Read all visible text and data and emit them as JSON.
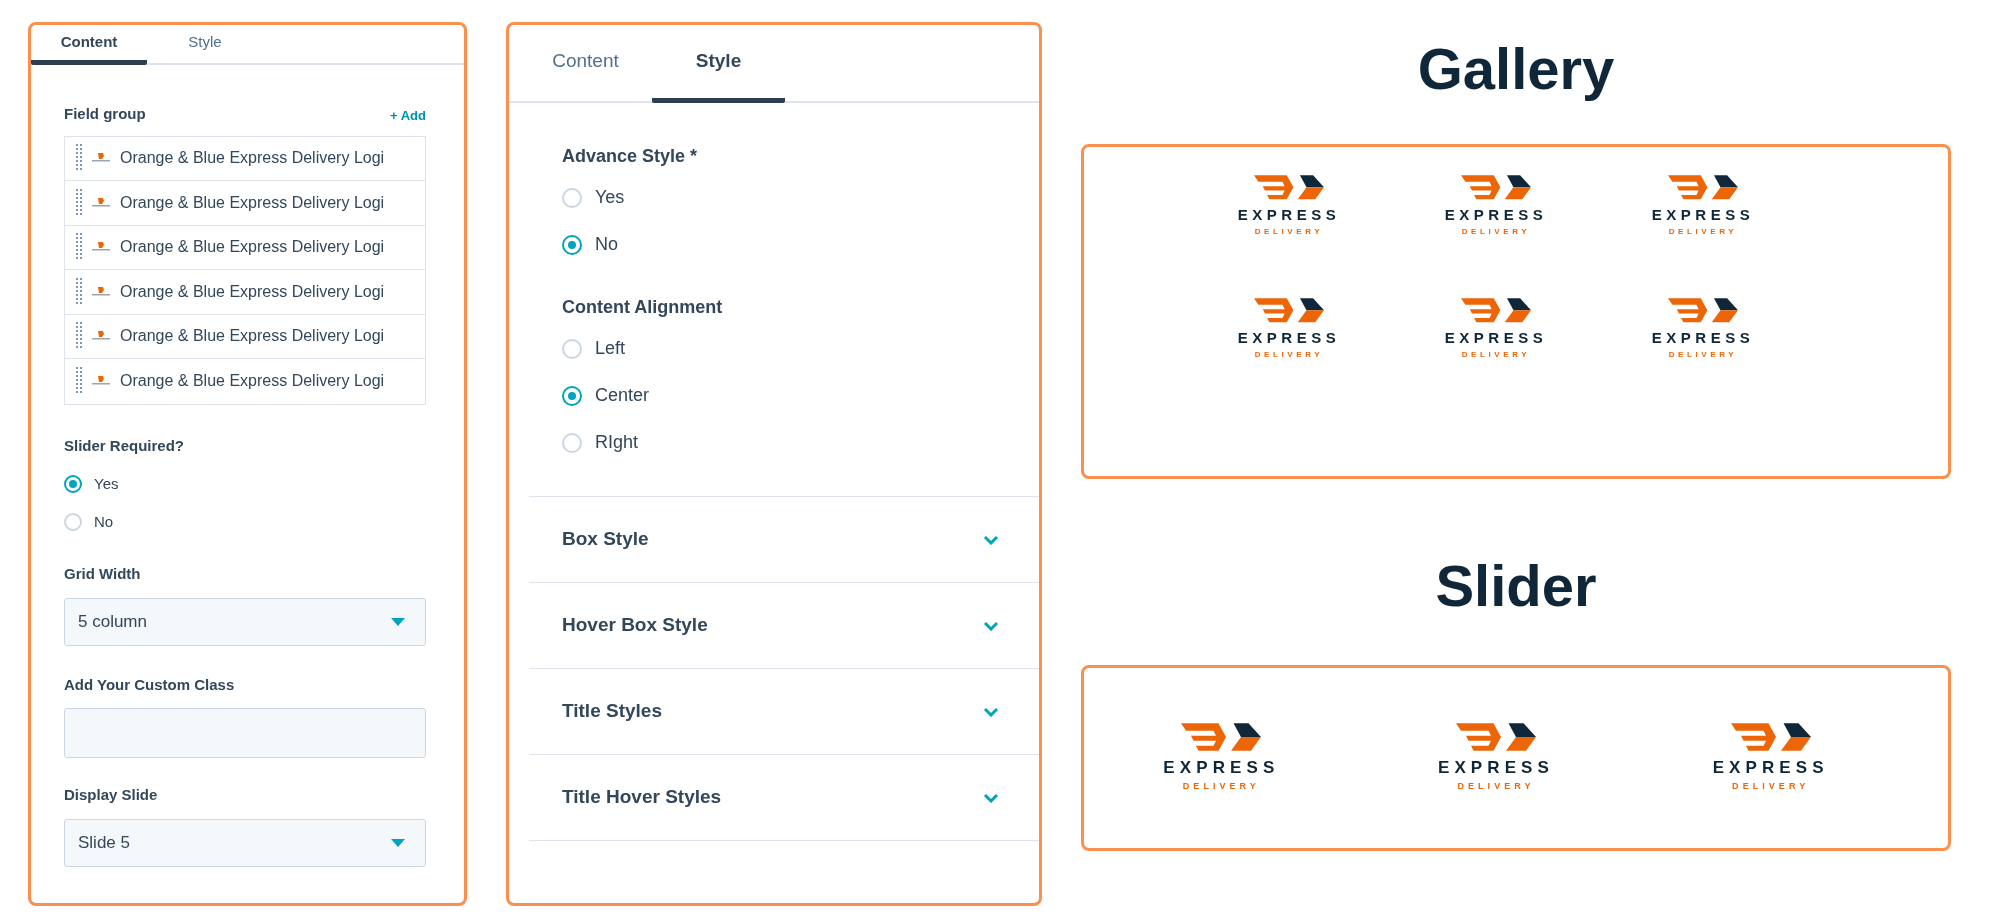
{
  "content_panel": {
    "tabs": [
      {
        "label": "Content",
        "selected": true
      },
      {
        "label": "Style",
        "selected": false
      }
    ],
    "field_group": {
      "label": "Field group",
      "add_link": "+ Add",
      "items": [
        {
          "label": "Orange & Blue Express Delivery Logi"
        },
        {
          "label": "Orange & Blue Express Delivery Logi"
        },
        {
          "label": "Orange & Blue Express Delivery Logi"
        },
        {
          "label": "Orange & Blue Express Delivery Logi"
        },
        {
          "label": "Orange & Blue Express Delivery Logi"
        },
        {
          "label": "Orange & Blue Express Delivery Logi"
        }
      ]
    },
    "slider_required": {
      "label": "Slider Required?",
      "options": [
        {
          "label": "Yes",
          "selected": true
        },
        {
          "label": "No",
          "selected": false
        }
      ]
    },
    "grid_width": {
      "label": "Grid Width",
      "value": "5 column"
    },
    "custom_class": {
      "label": "Add Your Custom Class"
    },
    "display_slide": {
      "label": "Display Slide",
      "value": "Slide 5"
    }
  },
  "style_panel": {
    "tabs": [
      {
        "label": "Content",
        "selected": false
      },
      {
        "label": "Style",
        "selected": true
      }
    ],
    "advance_style": {
      "label": "Advance Style *",
      "options": [
        {
          "label": "Yes",
          "selected": false
        },
        {
          "label": "No",
          "selected": true
        }
      ]
    },
    "content_alignment": {
      "label": "Content Alignment",
      "options": [
        {
          "label": "Left",
          "selected": false
        },
        {
          "label": "Center",
          "selected": true
        },
        {
          "label": "RIght",
          "selected": false
        }
      ]
    },
    "sections": [
      {
        "label": "Box Style",
        "expanded": false
      },
      {
        "label": "Hover Box Style",
        "expanded": false
      },
      {
        "label": "Title Styles",
        "expanded": false
      },
      {
        "label": "Title Hover Styles",
        "expanded": false
      }
    ]
  },
  "gallery": {
    "title": "Gallery",
    "logos": [
      {
        "name": "EXPRESS",
        "tagline": "DELIVERY"
      },
      {
        "name": "EXPRESS",
        "tagline": "DELIVERY"
      },
      {
        "name": "EXPRESS",
        "tagline": "DELIVERY"
      },
      {
        "name": "EXPRESS",
        "tagline": "DELIVERY"
      },
      {
        "name": "EXPRESS",
        "tagline": "DELIVERY"
      },
      {
        "name": "EXPRESS",
        "tagline": "DELIVERY"
      }
    ]
  },
  "slider": {
    "title": "Slider",
    "logos": [
      {
        "name": "EXPRESS",
        "tagline": "DELIVERY"
      },
      {
        "name": "EXPRESS",
        "tagline": "DELIVERY"
      },
      {
        "name": "EXPRESS",
        "tagline": "DELIVERY"
      }
    ]
  }
}
